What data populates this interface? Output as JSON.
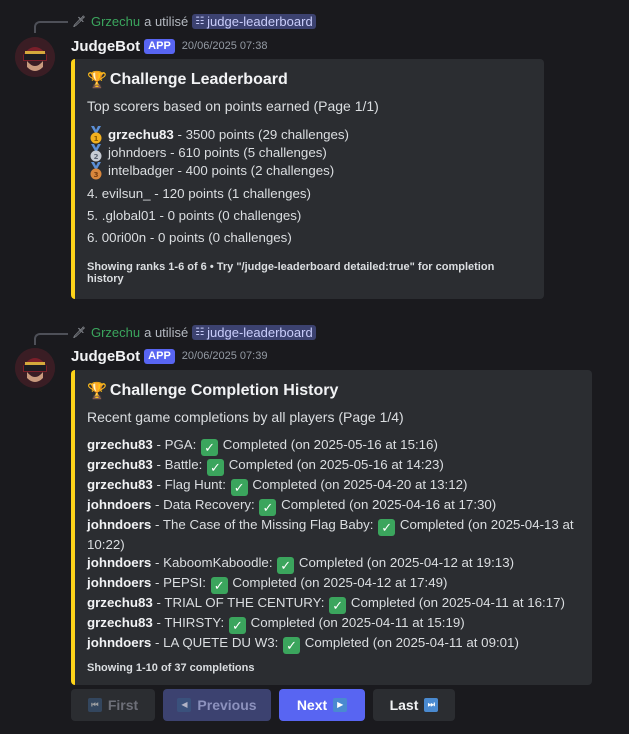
{
  "messages": [
    {
      "reply": {
        "user": "Grzechu",
        "verb": "a utilisé",
        "command": "judge-leaderboard"
      },
      "bot_name": "JudgeBot",
      "app_tag": "APP",
      "timestamp": "20/06/2025 07:38",
      "embed": {
        "title": "Challenge Leaderboard",
        "description": "Top scorers based on points earned (Page 1/1)",
        "medal_rows": [
          {
            "medal": "gold",
            "name": "grzechu83",
            "text": " - 3500 points (29 challenges)"
          },
          {
            "medal": "silver",
            "name": "johndoers",
            "text": " - 610 points (5 challenges)"
          },
          {
            "medal": "bronze",
            "name": "intelbadger",
            "text": " - 400 points (2 challenges)"
          }
        ],
        "plain_rows": [
          "4. evilsun_ - 120 points (1 challenges)",
          "5. .global01 - 0 points (0 challenges)",
          "6. 00ri00n - 0 points (0 challenges)"
        ],
        "footer": "Showing ranks 1-6 of 6 • Try \"/judge-leaderboard detailed:true\" for completion history"
      }
    },
    {
      "reply": {
        "user": "Grzechu",
        "verb": "a utilisé",
        "command": "judge-leaderboard"
      },
      "bot_name": "JudgeBot",
      "app_tag": "APP",
      "timestamp": "20/06/2025 07:39",
      "embed": {
        "title": "Challenge Completion History",
        "description": "Recent game completions by all players (Page 1/4)",
        "completions": [
          {
            "user": "grzechu83",
            "challenge": " - PGA: ",
            "status": " Completed (on 2025-05-16 at 15:16)"
          },
          {
            "user": "grzechu83",
            "challenge": " - Battle: ",
            "status": " Completed (on 2025-05-16 at 14:23)"
          },
          {
            "user": "grzechu83",
            "challenge": " - Flag Hunt: ",
            "status": " Completed (on 2025-04-20 at 13:12)"
          },
          {
            "user": "johndoers",
            "challenge": " - Data Recovery: ",
            "status": " Completed (on 2025-04-16 at 17:30)"
          },
          {
            "user": "johndoers",
            "challenge": " - The Case of the Missing Flag Baby: ",
            "status": " Completed (on 2025-04-13 at 10:22)"
          },
          {
            "user": "johndoers",
            "challenge": " - KaboomKaboodle: ",
            "status": " Completed (on 2025-04-12 at 19:13)"
          },
          {
            "user": "johndoers",
            "challenge": " - PEPSI: ",
            "status": " Completed (on 2025-04-12 at 17:49)"
          },
          {
            "user": "grzechu83",
            "challenge": " - TRIAL OF THE CENTURY: ",
            "status": " Completed (on 2025-04-11 at 16:17)"
          },
          {
            "user": "grzechu83",
            "challenge": " - THIRSTY: ",
            "status": " Completed (on 2025-04-11 at 15:19)"
          },
          {
            "user": "johndoers",
            "challenge": " - LA QUETE DU W3: ",
            "status": " Completed (on 2025-04-11 at 09:01)"
          }
        ],
        "footer": "Showing 1-10 of 37 completions"
      },
      "buttons": {
        "first": "First",
        "previous": "Previous",
        "next": "Next",
        "last": "Last"
      }
    }
  ],
  "colors": {
    "accent": "#fdd31a",
    "blurple": "#5865f2",
    "reply_user": "#3ba55d",
    "check": "#3ba55d"
  }
}
